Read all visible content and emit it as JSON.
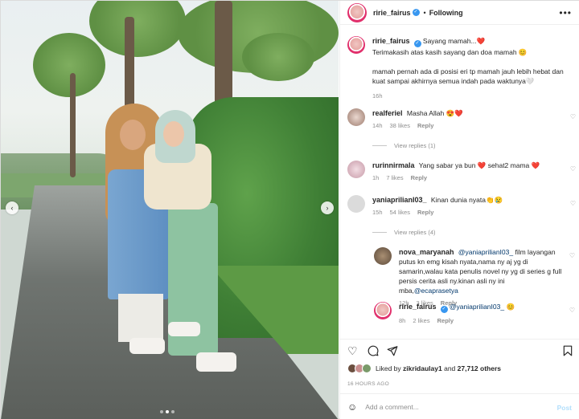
{
  "header": {
    "username": "ririe_fairus",
    "verified_mark": "✓",
    "separator": "•",
    "follow_label": "Following",
    "more_icon": "more-icon"
  },
  "caption": {
    "username": "ririe_fairus",
    "lines": [
      "Sayang mamah...❤️",
      "Terimakasih atas kasih sayang dan doa mamah 😊"
    ],
    "paragraph": "mamah pernah ada di posisi eri tp mamah jauh lebih hebat dan kuat sampai akhirnya semua indah pada waktunya🤍",
    "time": "16h"
  },
  "comments": [
    {
      "username": "realferiel",
      "text": "Masha Allah 😍❤️",
      "time": "14h",
      "likes": "38 likes",
      "reply": "Reply",
      "view_replies": "View replies (1)"
    },
    {
      "username": "rurinnirmala",
      "text": "Yang sabar ya bun ❤️ sehat2 mama ❤️",
      "time": "1h",
      "likes": "7 likes",
      "reply": "Reply"
    },
    {
      "username": "yaniaprilianI03_",
      "text": "Kinan dunia nyata👏😢",
      "time": "15h",
      "likes": "54 likes",
      "reply": "Reply",
      "view_replies": "View replies (4)"
    }
  ],
  "replies": [
    {
      "username": "nova_maryanah",
      "mention": "@yaniaprilianI03_",
      "text": "film layangan putus kn emg kisah nyata,nama ny aj yg di samarin,walau kata penulis novel ny yg di series g full persis cerita asli ny.kinan asli ny ini mba,",
      "mention2": "@ecaprasetya",
      "time": "12h",
      "likes": "3 likes",
      "reply": "Reply"
    },
    {
      "username": "ririe_fairus",
      "mention": "@yaniaprilianI03_",
      "text": "😊",
      "time": "8h",
      "likes": "2 likes",
      "reply": "Reply"
    }
  ],
  "actions": {
    "like_icon": "heart-icon",
    "comment_icon": "comment-icon",
    "share_icon": "share-icon",
    "save_icon": "bookmark-icon"
  },
  "likes": {
    "prefix": "Liked by",
    "user": "zikridaulay1",
    "middle": "and",
    "count": "27,712 others"
  },
  "timestamp": "16 HOURS AGO",
  "add_comment": {
    "placeholder": "Add a comment...",
    "post_label": "Post"
  },
  "photo": {
    "prev_icon": "chevron-left-icon",
    "next_icon": "chevron-right-icon"
  },
  "colors": {
    "accent": "#3897f0",
    "heart": "#ed4956",
    "muted": "#8e8e8e",
    "link": "#00376b"
  }
}
